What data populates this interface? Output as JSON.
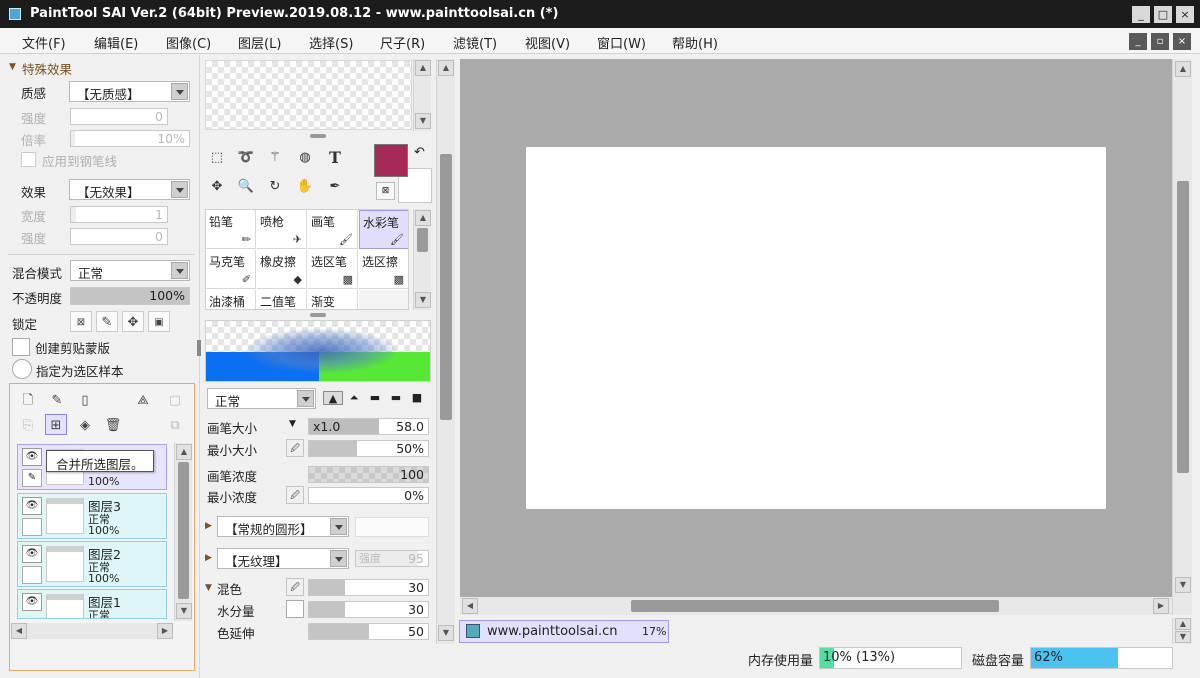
{
  "window": {
    "title": "PaintTool SAI Ver.2 (64bit) Preview.2019.08.12 - www.painttoolsai.cn (*)"
  },
  "window_buttons": [
    "_",
    "□",
    "×"
  ],
  "mdi_buttons": [
    "_",
    "▫",
    "×"
  ],
  "menu": [
    "文件(F)",
    "编辑(E)",
    "图像(C)",
    "图层(L)",
    "选择(S)",
    "尺子(R)",
    "滤镜(T)",
    "视图(V)",
    "窗口(W)",
    "帮助(H)"
  ],
  "effects": {
    "section_title": "特殊效果",
    "texture_label": "质感",
    "texture_value": "【无质感】",
    "strength_label": "强度",
    "strength_value": "0",
    "scale_label": "倍率",
    "scale_value": "10%",
    "apply_line": "应用到钢笔线",
    "effect_label": "效果",
    "effect_value": "【无效果】",
    "width_label": "宽度",
    "width_value": "1",
    "strength2_label": "强度",
    "strength2_value": "0"
  },
  "layer_props": {
    "blend_label": "混合模式",
    "blend_value": "正常",
    "opacity_label": "不透明度",
    "opacity_value": "100%",
    "opacity_level": 1.0,
    "lock_label": "锁定",
    "clip_label": "创建剪贴蒙版",
    "sample_label": "指定为选区样本"
  },
  "layers": {
    "tooltip": "合并所选图层。",
    "items": [
      {
        "name": "",
        "mode": "",
        "opacity": "100%",
        "selected": true
      },
      {
        "name": "图层3",
        "mode": "正常",
        "opacity": "100%",
        "selected": false
      },
      {
        "name": "图层2",
        "mode": "正常",
        "opacity": "100%",
        "selected": false
      },
      {
        "name": "图层1",
        "mode": "正常",
        "opacity": "",
        "selected": false
      }
    ]
  },
  "colors": {
    "primary": "#a52a5a",
    "accent_green": "#57e836",
    "accent_blue": "#0a6ff0"
  },
  "tools": {
    "row1": [
      "select-rect-icon",
      "lasso-icon",
      "magic-wand-icon",
      "bucket-icon",
      "text-icon"
    ],
    "row2": [
      "move-icon",
      "zoom-icon",
      "rotate-icon",
      "hand-icon",
      "eyedropper-icon"
    ],
    "text_glyph": "T"
  },
  "brushes": [
    {
      "label": "铅笔",
      "selected": false
    },
    {
      "label": "喷枪",
      "selected": false
    },
    {
      "label": "画笔",
      "selected": false
    },
    {
      "label": "水彩笔",
      "selected": true
    },
    {
      "label": "马克笔",
      "selected": false
    },
    {
      "label": "橡皮擦",
      "selected": false
    },
    {
      "label": "选区笔",
      "selected": false
    },
    {
      "label": "选区擦",
      "selected": false
    },
    {
      "label": "油漆桶",
      "selected": false
    },
    {
      "label": "二值笔",
      "selected": false
    },
    {
      "label": "渐变",
      "selected": false
    },
    {
      "label": "",
      "selected": false
    }
  ],
  "brush_settings": {
    "mode_value": "正常",
    "size_label": "画笔大小",
    "size_mult": "x1.0",
    "size_value": "58.0",
    "min_size_label": "最小大小",
    "min_size_value": "50%",
    "density_label": "画笔浓度",
    "density_value": "100",
    "min_density_label": "最小浓度",
    "min_density_value": "0%",
    "shape_value": "【常规的圆形】",
    "texture_value": "【无纹理】",
    "texture_strength_label": "强度",
    "texture_strength_value": "95",
    "blend_label": "混色",
    "blend_value": "30",
    "water_label": "水分量",
    "water_value": "30",
    "stretch_label": "色延伸",
    "stretch_value": "50"
  },
  "navigator": {
    "name": "www.painttoolsai.cn",
    "zoom": "17%"
  },
  "status": {
    "memory_label": "内存使用量",
    "memory_value": "10% (13%)",
    "memory_level": 0.1,
    "disk_label": "磁盘容量",
    "disk_value": "62%",
    "disk_level": 0.62
  }
}
